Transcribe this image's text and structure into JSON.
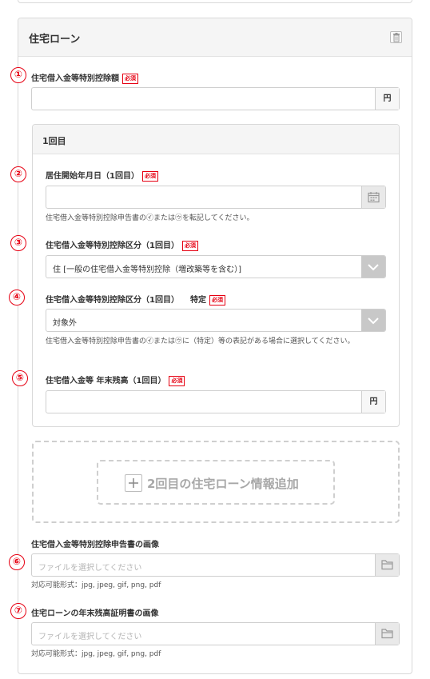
{
  "section": {
    "title": "住宅ローン",
    "trash_icon": "trash-icon"
  },
  "fields": {
    "deduction_amount": {
      "number": "①",
      "label": "住宅借入金等特別控除額",
      "required": "必須",
      "unit": "円",
      "value": ""
    },
    "sub": {
      "title": "1回目",
      "move_in_date": {
        "number": "②",
        "label": "居住開始年月日（1回目）",
        "required": "必須",
        "value": "",
        "help": "住宅借入金等特別控除申告書の㋑または㋒を転記してください。",
        "icon": "calendar-icon"
      },
      "deduction_type": {
        "number": "③",
        "label": "住宅借入金等特別控除区分（1回目）",
        "required": "必須",
        "selected": "住 [一般の住宅借入金等特別控除（増改築等を含む）]"
      },
      "special_type": {
        "number": "④",
        "label": "住宅借入金等特別控除区分（1回目）",
        "label_suffix": "特定",
        "required": "必須",
        "selected": "対象外",
        "help": "住宅借入金等特別控除申告書の㋑または㋒に（特定）等の表記がある場合に選択してください。"
      },
      "balance": {
        "number": "⑤",
        "label": "住宅借入金等 年末残高（1回目）",
        "required": "必須",
        "unit": "円",
        "value": ""
      }
    },
    "add_second": {
      "label": "2回目の住宅ローン情報追加"
    },
    "deduction_image": {
      "number": "⑥",
      "label": "住宅借入金等特別控除申告書の画像",
      "placeholder": "ファイルを選択してください",
      "help": "対応可能形式：jpg, jpeg, gif, png, pdf",
      "icon": "folder-icon"
    },
    "balance_image": {
      "number": "⑦",
      "label": "住宅ローンの年末残高証明書の画像",
      "placeholder": "ファイルを選択してください",
      "help": "対応可能形式：jpg, jpeg, gif, png, pdf",
      "icon": "folder-icon"
    }
  },
  "colors": {
    "required": "#e60012",
    "annotation": "#e60012",
    "border": "#cfcfcf"
  }
}
